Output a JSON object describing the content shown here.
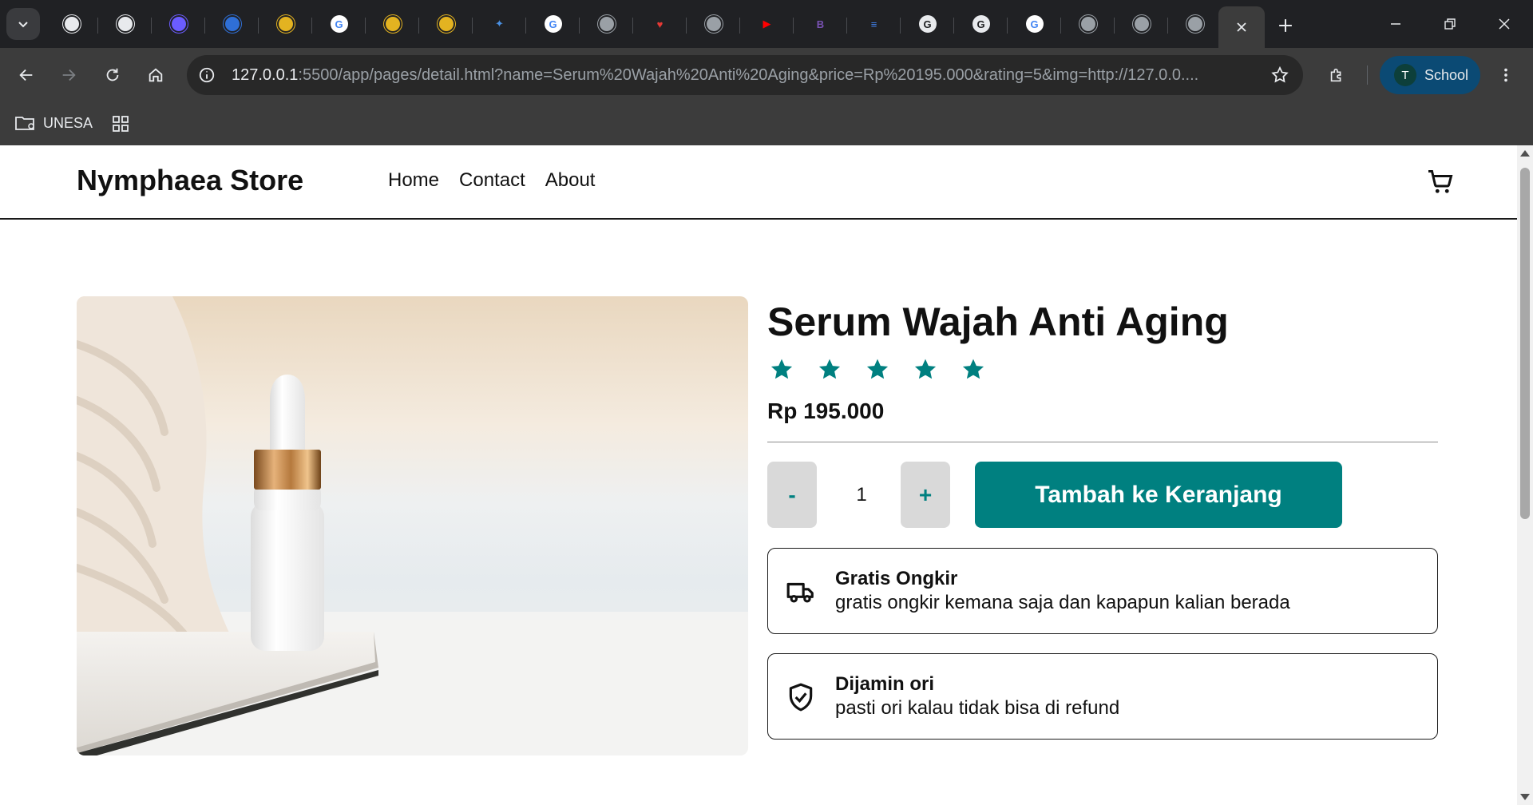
{
  "browser": {
    "tabs": [
      {
        "icon": "chromium-icon",
        "color": "#e8eaed",
        "glyph": ""
      },
      {
        "icon": "chromium-icon",
        "color": "#e8eaed",
        "glyph": ""
      },
      {
        "icon": "hexagon-icon",
        "color": "#6b5cff",
        "glyph": ""
      },
      {
        "icon": "blue-bowl-icon",
        "color": "#2f6fd6",
        "glyph": ""
      },
      {
        "icon": "university-crest-icon",
        "color": "#e3b321",
        "glyph": ""
      },
      {
        "icon": "google-icon",
        "color": "#ffffff",
        "glyph": "G"
      },
      {
        "icon": "university-crest-icon",
        "color": "#e3b321",
        "glyph": ""
      },
      {
        "icon": "university-crest-icon",
        "color": "#e3b321",
        "glyph": ""
      },
      {
        "icon": "gemini-icon",
        "color": "#4a90e2",
        "glyph": "✦"
      },
      {
        "icon": "google-icon",
        "color": "#ffffff",
        "glyph": "G"
      },
      {
        "icon": "globe-icon",
        "color": "#9aa0a6",
        "glyph": ""
      },
      {
        "icon": "heart-mail-icon",
        "color": "#e53935",
        "glyph": "♥"
      },
      {
        "icon": "globe-icon",
        "color": "#9aa0a6",
        "glyph": ""
      },
      {
        "icon": "youtube-icon",
        "color": "#ff0000",
        "glyph": "▶"
      },
      {
        "icon": "bootstrap-icon",
        "color": "#7952b3",
        "glyph": "B"
      },
      {
        "icon": "google-docs-icon",
        "color": "#4285f4",
        "glyph": "≡"
      },
      {
        "icon": "google-g-icon",
        "color": "#202124",
        "glyph": "G"
      },
      {
        "icon": "google-g-icon",
        "color": "#202124",
        "glyph": "G"
      },
      {
        "icon": "google-icon",
        "color": "#ffffff",
        "glyph": "G"
      },
      {
        "icon": "globe-icon",
        "color": "#9aa0a6",
        "glyph": ""
      },
      {
        "icon": "globe-icon",
        "color": "#9aa0a6",
        "glyph": ""
      },
      {
        "icon": "globe-icon",
        "color": "#9aa0a6",
        "glyph": ""
      }
    ],
    "url_host": "127.0.0.1",
    "url_rest": ":5500/app/pages/detail.html?name=Serum%20Wajah%20Anti%20Aging&price=Rp%20195.000&rating=5&img=http://127.0.0....",
    "profile_initial": "T",
    "profile_label": "School",
    "bookmark_folder": "UNESA"
  },
  "navbar": {
    "brand": "Nymphaea Store",
    "links": [
      "Home",
      "Contact",
      "About"
    ]
  },
  "product": {
    "name": "Serum Wajah Anti Aging",
    "rating": 5,
    "price": "Rp 195.000",
    "quantity": "1",
    "minus_label": "-",
    "plus_label": "+",
    "add_to_cart_label": "Tambah ke Keranjang"
  },
  "features": [
    {
      "icon": "truck-icon",
      "title": "Gratis Ongkir",
      "desc": "gratis ongkir kemana saja dan kapapun kalian berada"
    },
    {
      "icon": "shield-check-icon",
      "title": "Dijamin ori",
      "desc": "pasti ori kalau tidak bisa di refund"
    }
  ],
  "colors": {
    "accent": "#008080",
    "star": "#008080",
    "qty_button_bg": "#d9d9d9"
  }
}
